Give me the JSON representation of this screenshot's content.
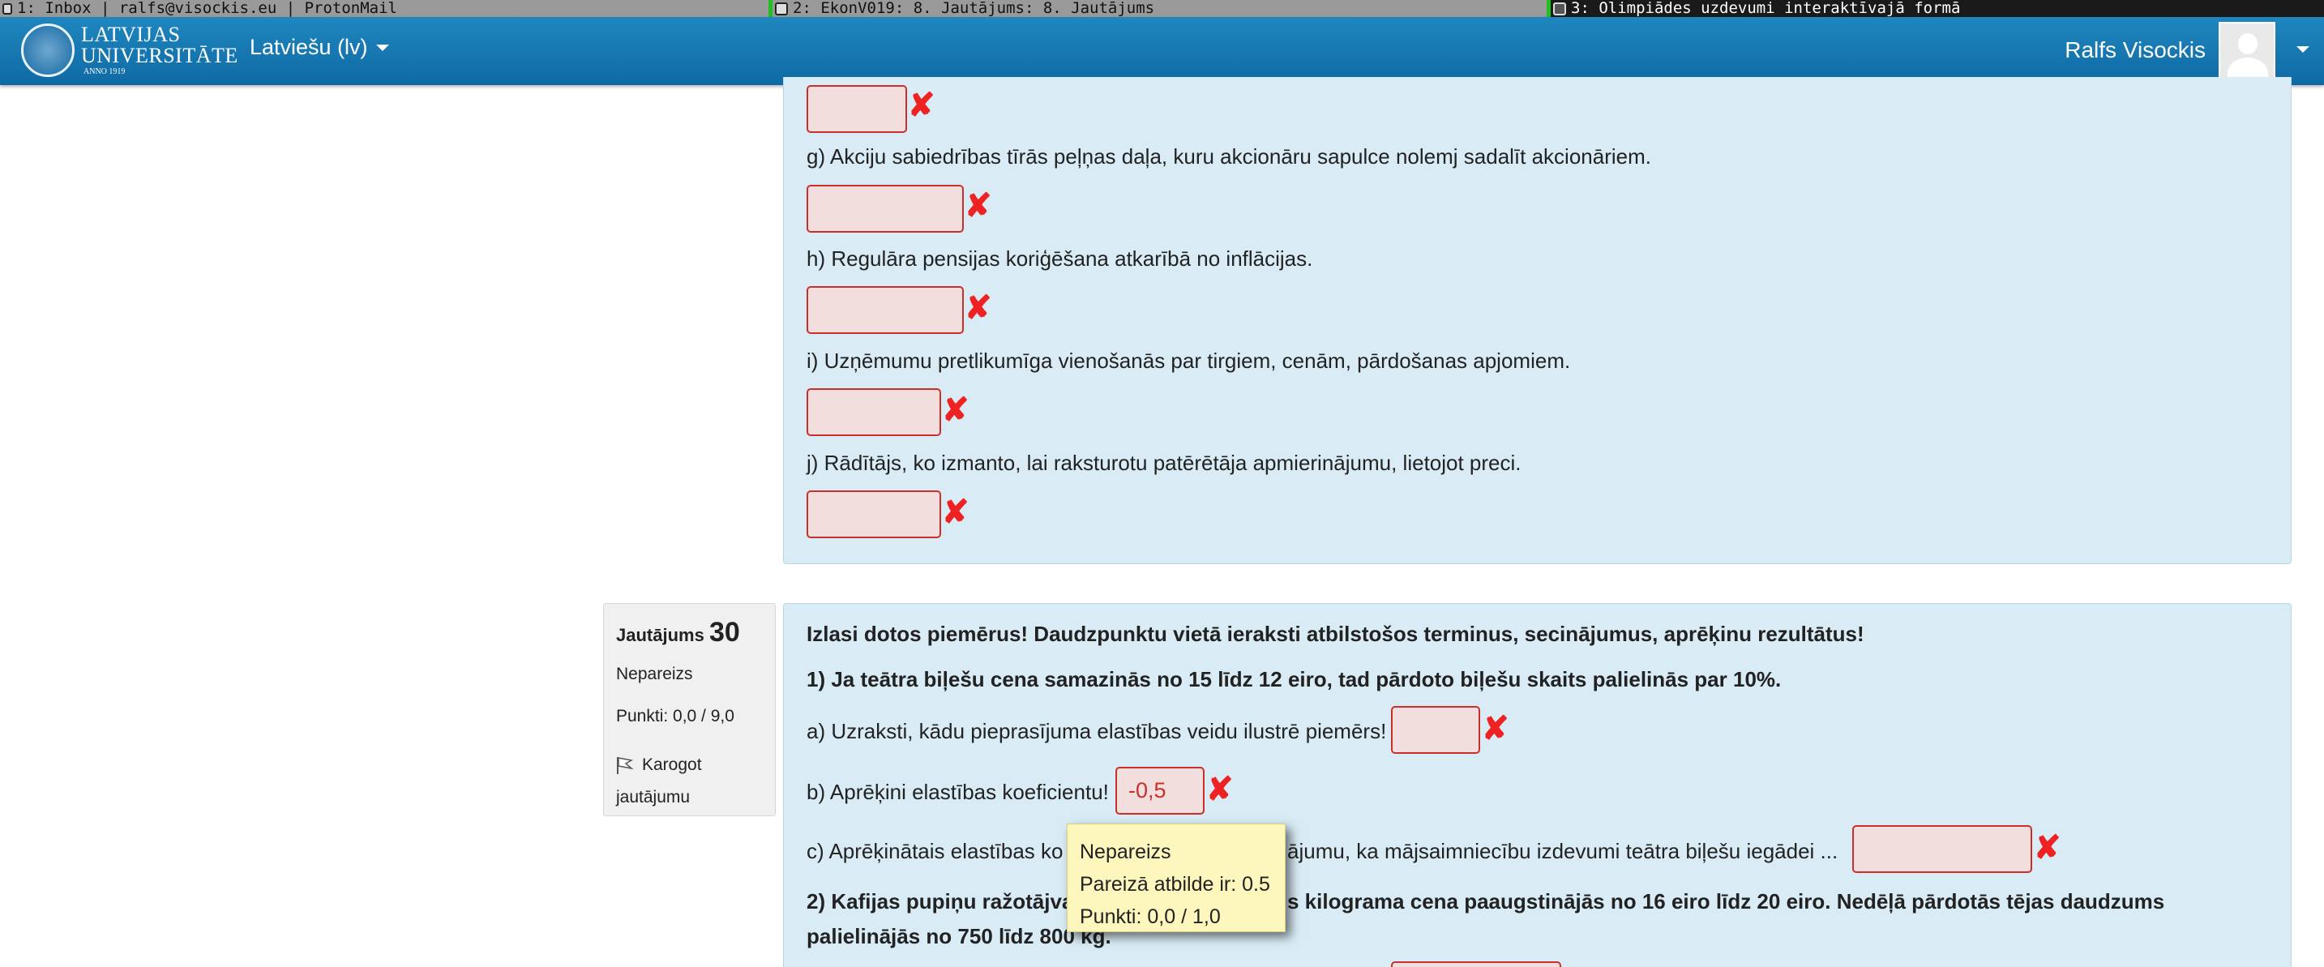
{
  "wm_bar": {
    "tabs": [
      {
        "label": "1: Inbox | ralfs@visockis.eu | ProtonMail"
      },
      {
        "label": "2: EkonV019: 8. Jautājums: 8. Jautājums"
      },
      {
        "label": "3: Olimpiādes uzdevumi interaktīvajā formā"
      }
    ]
  },
  "navbar": {
    "logo": {
      "line1": "LATVIJAS",
      "line2": "UNIVERSITĀTE",
      "line3": "ANNO 1919"
    },
    "language": "Latviešu (lv)",
    "user_name": "Ralfs Visockis"
  },
  "prev_question": {
    "items": [
      {
        "text": "g) Akciju sabiedrības tīrās peļņas daļa, kuru akcionāru sapulce nolemj sadalīt akcionāriem.",
        "value": ""
      },
      {
        "text": "h) Regulāra pensijas koriģēšana atkarībā no inflācijas.",
        "value": ""
      },
      {
        "text": "i) Uzņēmumu pretlikumīga vienošanās par tirgiem, cenām, pārdošanas apjomiem.",
        "value": ""
      },
      {
        "text": "j) Rādītājs, ko izmanto, lai raksturotu patērētāja apmierinājumu, lietojot preci.",
        "value": ""
      }
    ]
  },
  "question30": {
    "label": "Jautājums",
    "number": "30",
    "state": "Nepareizs",
    "grade": "Punkti: 0,0 / 9,0",
    "flag_label": "Karogot jautājumu",
    "intro": "Izlasi dotos piemērus! Daudzpunktu vietā ieraksti atbilstošos terminus, secinājumus, aprēķinu rezultātus!",
    "part1": "1) Ja teātra biļešu cena samazinās no 15 līdz 12 eiro, tad pārdoto biļešu skaits palielinās par 10%.",
    "a": {
      "text": "a) Uzraksti, kādu pieprasījuma elastības veidu ilustrē piemērs!",
      "value": ""
    },
    "b": {
      "text": "b) Aprēķini elastības koeficientu!",
      "value": "-0,5"
    },
    "c": {
      "text_before": "c) Aprēķinātais elastības ko",
      "text_after": "ājumu, ka mājsaimniecību izdevumi teātra biļešu iegādei ...",
      "value": ""
    },
    "part2_line1_before": "2) Kafijas pupiņu ražotājva",
    "part2_line1_after": "s kilograma cena paaugstinājās no 16 eiro līdz 20 eiro. Nedēļā pārdotās tējas daudzums",
    "part2_line2": "palielinājās no 750 līdz 800 kg."
  },
  "tooltip": {
    "line1": "Nepareizs",
    "line2": "Pareizā atbilde ir: 0.5",
    "line3": "Punkti: 0,0 / 1,0"
  }
}
